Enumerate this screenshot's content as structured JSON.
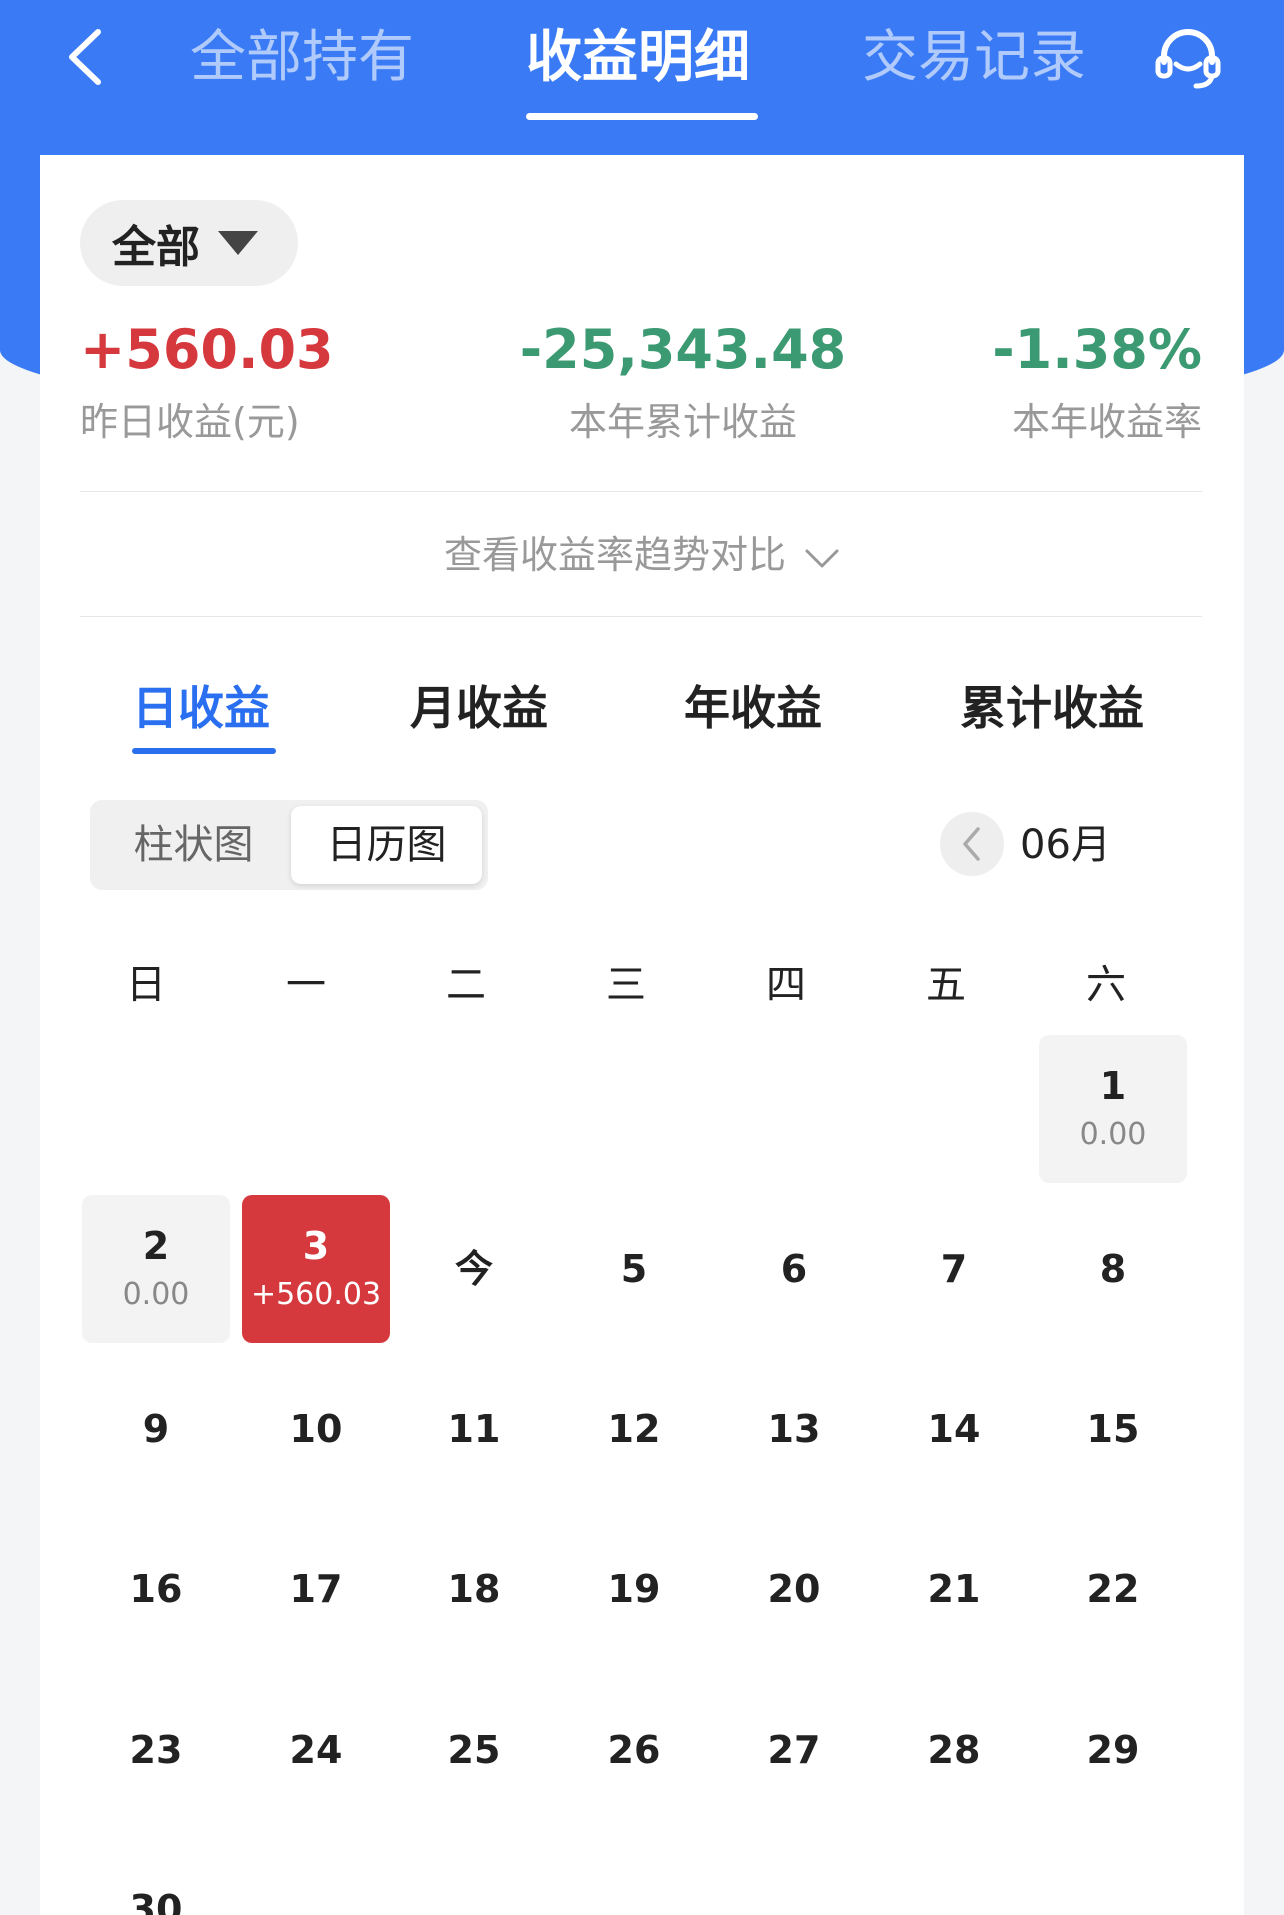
{
  "nav": {
    "tabs": [
      {
        "label": "全部持有"
      },
      {
        "label": "收益明细"
      },
      {
        "label": "交易记录"
      }
    ]
  },
  "filter": {
    "label": "全部"
  },
  "stats": {
    "yesterday": {
      "value": "+560.03",
      "label": "昨日收益(元)"
    },
    "year_total": {
      "value": "-25,343.48",
      "label": "本年累计收益"
    },
    "year_rate": {
      "value": "-1.38%",
      "label": "本年收益率"
    }
  },
  "trend_link": "查看收益率趋势对比",
  "subtabs": [
    "日收益",
    "月收益",
    "年收益",
    "累计收益"
  ],
  "view_toggle": {
    "bar": "柱状图",
    "calendar": "日历图"
  },
  "month": "06月",
  "weekdays": [
    "日",
    "一",
    "二",
    "三",
    "四",
    "五",
    "六"
  ],
  "days": [
    {
      "num": "1",
      "amt": "0.00"
    },
    {
      "num": "2",
      "amt": "0.00"
    },
    {
      "num": "3",
      "amt": "+560.03"
    },
    {
      "num": "今"
    },
    {
      "num": "5"
    },
    {
      "num": "6"
    },
    {
      "num": "7"
    },
    {
      "num": "8"
    },
    {
      "num": "9"
    },
    {
      "num": "10"
    },
    {
      "num": "11"
    },
    {
      "num": "12"
    },
    {
      "num": "13"
    },
    {
      "num": "14"
    },
    {
      "num": "15"
    },
    {
      "num": "16"
    },
    {
      "num": "17"
    },
    {
      "num": "18"
    },
    {
      "num": "19"
    },
    {
      "num": "20"
    },
    {
      "num": "21"
    },
    {
      "num": "22"
    },
    {
      "num": "23"
    },
    {
      "num": "24"
    },
    {
      "num": "25"
    },
    {
      "num": "26"
    },
    {
      "num": "27"
    },
    {
      "num": "28"
    },
    {
      "num": "29"
    },
    {
      "num": "30"
    }
  ],
  "colors": {
    "primary": "#3a7bf5",
    "accent_blue": "#2a6ff0",
    "gain_red": "#d6393d",
    "loss_green": "#3c9a72"
  }
}
